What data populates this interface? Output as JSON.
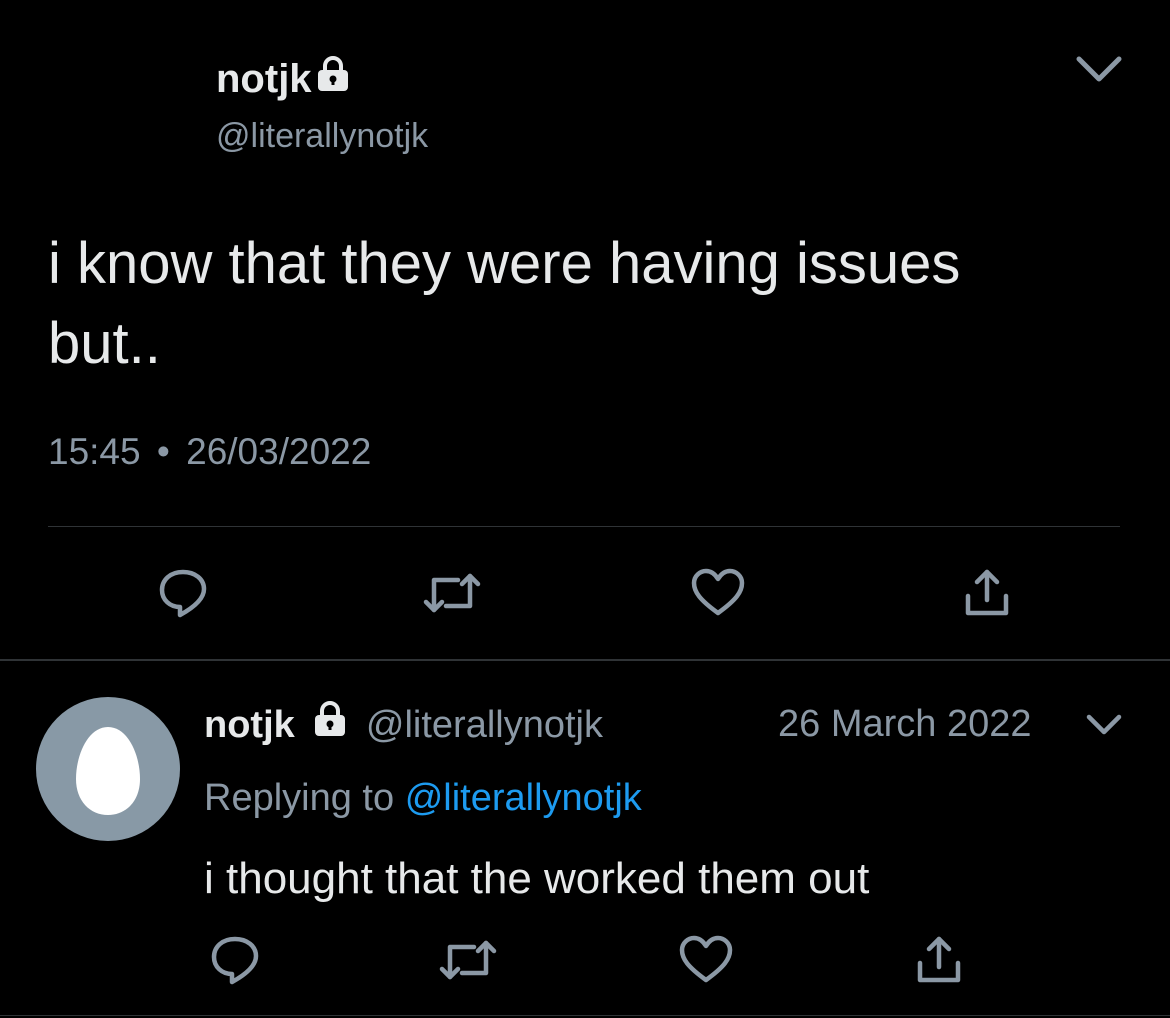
{
  "main_tweet": {
    "display_name": "notjk",
    "handle": "@literallynotjk",
    "text_line1": "i know that they were having issues",
    "text_line2": "but..",
    "time": "15:45",
    "separator": "•",
    "date": "26/03/2022",
    "icons": [
      "chevron-down-icon",
      "lock-icon",
      "reply-icon",
      "retweet-icon",
      "like-icon",
      "share-icon"
    ]
  },
  "reply_tweet": {
    "display_name": "notjk",
    "handle": "@literallynotjk",
    "date": "26 March 2022",
    "replying_prefix": "Replying to",
    "replying_handle": "@literallynotjk",
    "text": "i thought that the worked them out",
    "avatar_icon": "default-egg-avatar"
  },
  "colors": {
    "background": "#000000",
    "text": "#e7e9ea",
    "muted": "#8b98a5",
    "link": "#1d9bf0",
    "divider": "#2f3336",
    "avatar_bg": "#8899a6"
  }
}
